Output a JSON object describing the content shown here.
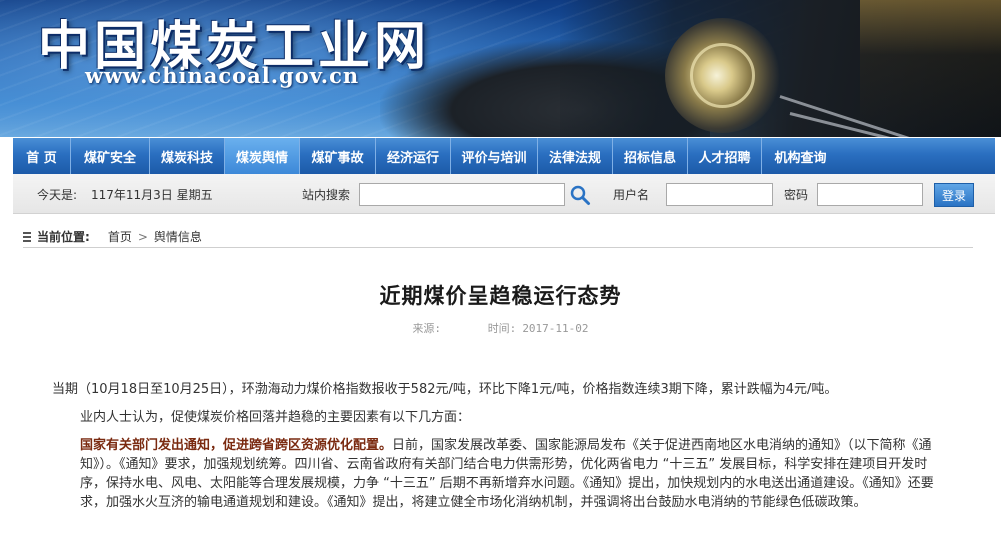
{
  "header": {
    "site_title": "中国煤炭工业网",
    "site_url": "www.chinacoal.gov.cn"
  },
  "nav": {
    "items": [
      {
        "label": "首 页",
        "active": false
      },
      {
        "label": "煤矿安全",
        "active": false
      },
      {
        "label": "煤炭科技",
        "active": false
      },
      {
        "label": "煤炭舆情",
        "active": true
      },
      {
        "label": "煤矿事故",
        "active": false
      },
      {
        "label": "经济运行",
        "active": false
      },
      {
        "label": "评价与培训",
        "active": false
      },
      {
        "label": "法律法规",
        "active": false
      },
      {
        "label": "招标信息",
        "active": false
      },
      {
        "label": "人才招聘",
        "active": false
      },
      {
        "label": "机构查询",
        "active": false
      }
    ]
  },
  "toolbar": {
    "today_label": "今天是:",
    "today_value": "117年11月3日 星期五",
    "search_label": "站内搜索",
    "search_value": "",
    "username_label": "用户名",
    "username_value": "",
    "password_label": "密码",
    "password_value": "",
    "login_label": "登录"
  },
  "breadcrumb": {
    "label": "当前位置:",
    "home": "首页",
    "separator": ">",
    "current": "舆情信息"
  },
  "article": {
    "title": "近期煤价呈趋稳运行态势",
    "source_label": "来源:",
    "source_value": "",
    "time_label": "时间:",
    "time_value": "2017-11-02",
    "para1": "当期（10月18日至10月25日），环渤海动力煤价格指数报收于582元/吨，环比下降1元/吨，价格指数连续3期下降，累计跌幅为4元/吨。",
    "para2": "业内人士认为，促使煤炭价格回落并趋稳的主要因素有以下几方面：",
    "para3_lead": "国家有关部门发出通知，促进跨省跨区资源优化配置。",
    "para3_body": "日前，国家发展改革委、国家能源局发布《关于促进西南地区水电消纳的通知》（以下简称《通知》）。《通知》要求，加强规划统筹。四川省、云南省政府有关部门结合电力供需形势，优化两省电力 “十三五” 发展目标，科学安排在建项目开发时序，保持水电、风电、太阳能等合理发展规模，力争 “十三五” 后期不再新增弃水问题。《通知》提出，加快规划内的水电送出通道建设。《通知》还要求，加强水火互济的输电通道规划和建设。《通知》提出，将建立健全市场化消纳机制，并强调将出台鼓励水电消纳的节能绿色低碳政策。"
  },
  "colors": {
    "nav_blue": "#2a6fc0",
    "nav_active": "#3c88d8",
    "lead_text": "#7a2a10",
    "login_button": "#2a73c4"
  }
}
